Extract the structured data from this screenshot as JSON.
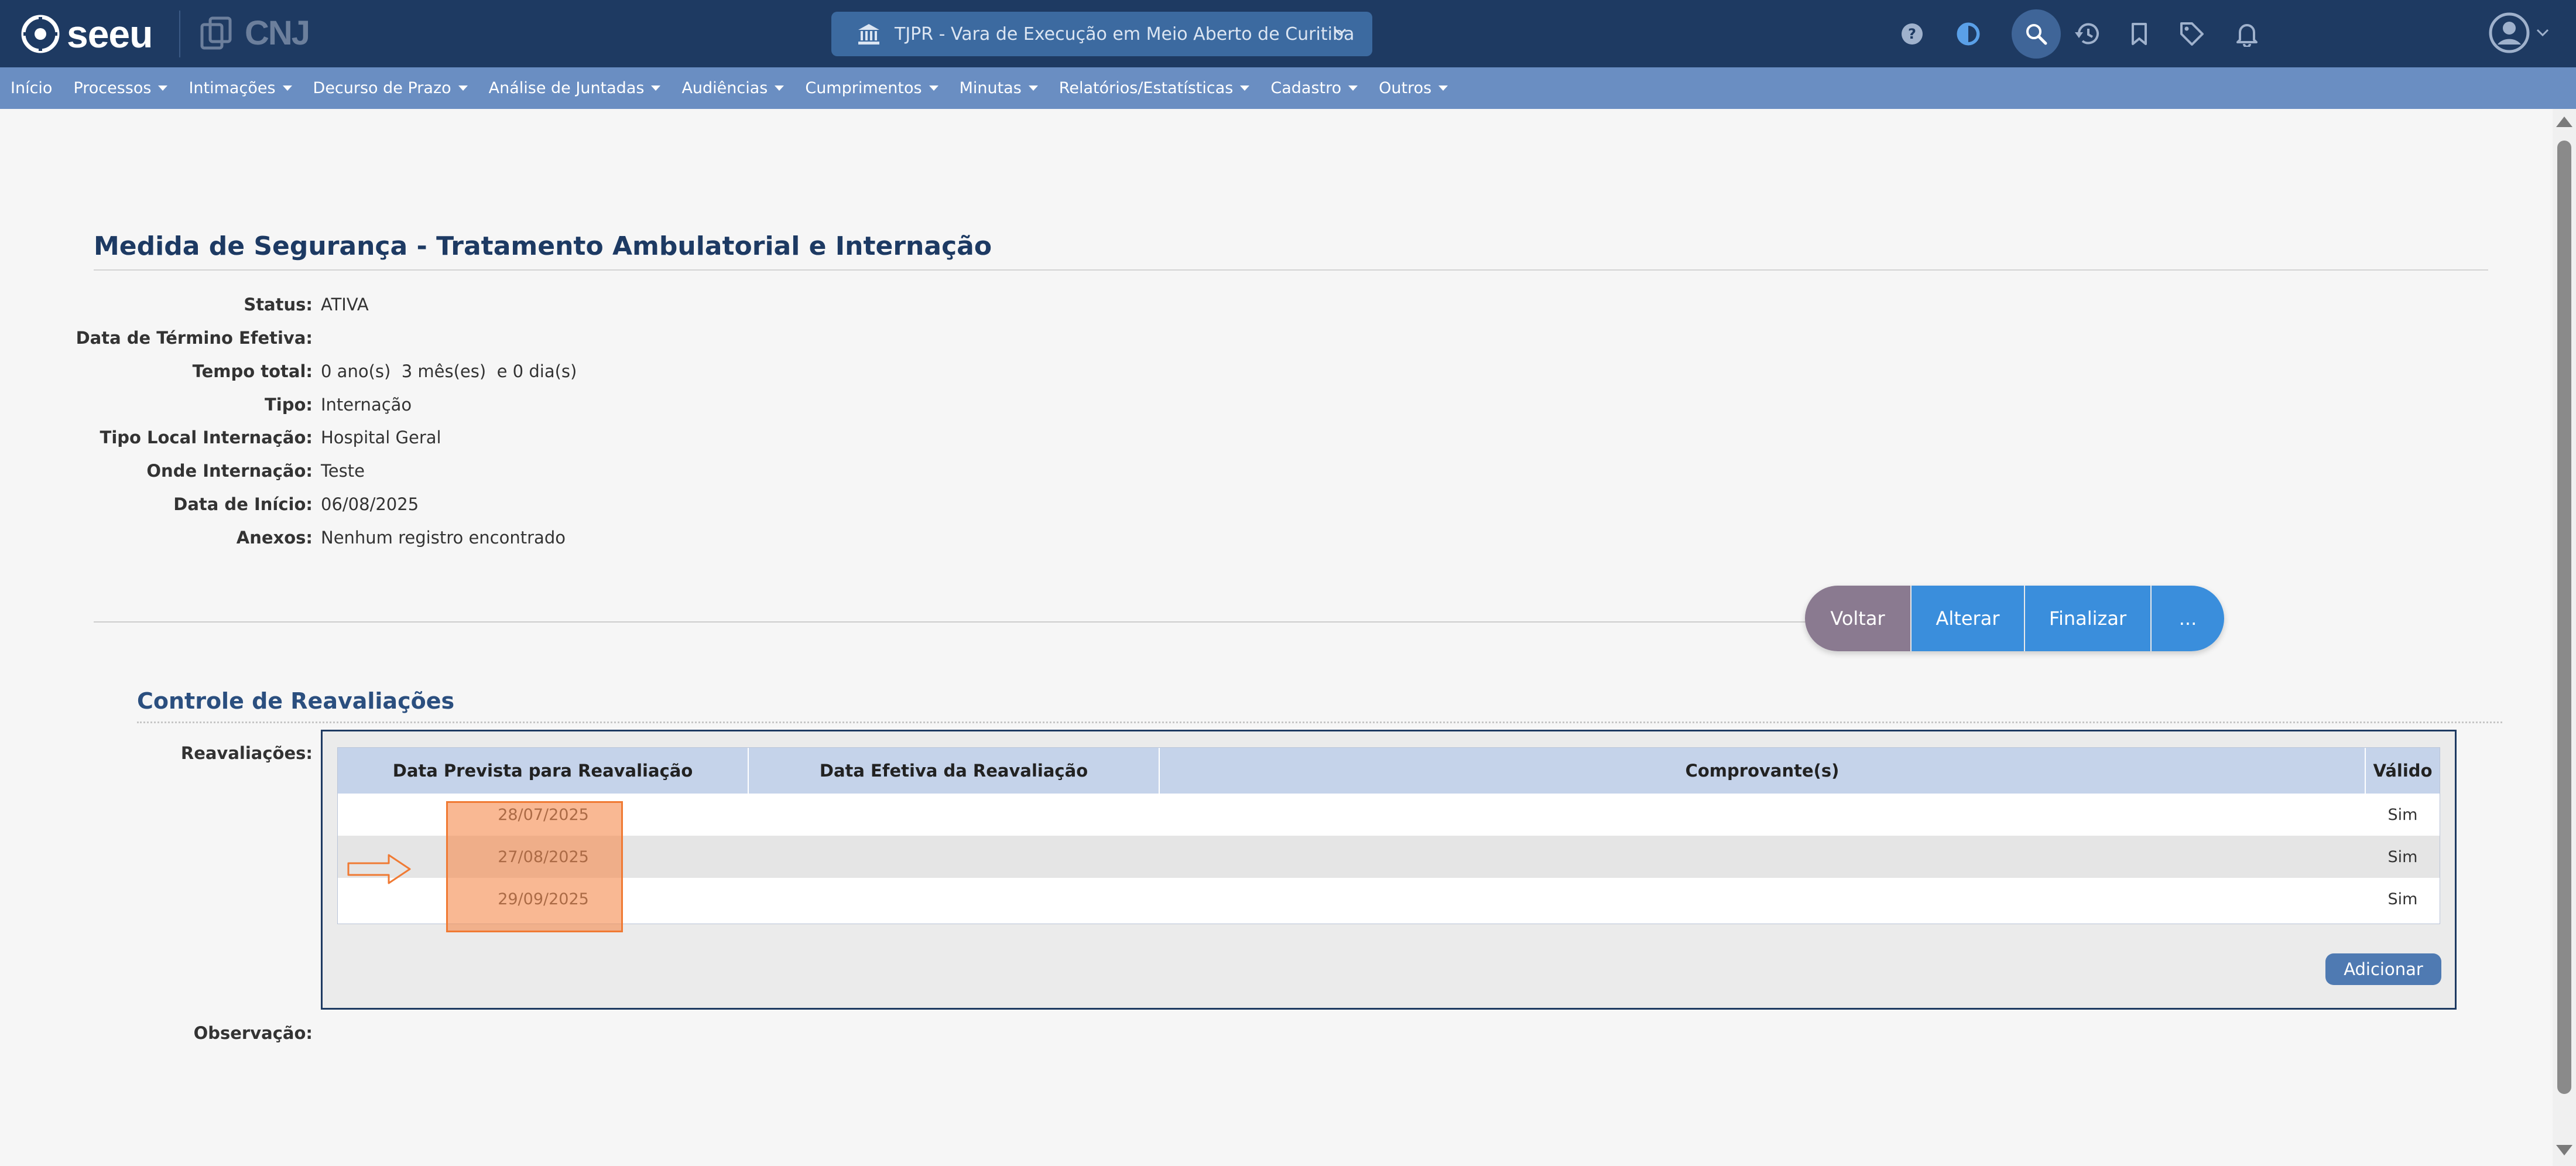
{
  "brand": {
    "name": "seeu",
    "partner": "CNJ",
    "icon": "seeu-logo-icon"
  },
  "court_selector": {
    "label": "TJPR - Vara de Execução em Meio Aberto de Curitiba",
    "icon": "court-building-icon"
  },
  "top_icons": [
    "help-icon",
    "theme-toggle-icon",
    "search-icon",
    "history-icon",
    "bookmark-icon",
    "tag-icon",
    "bell-icon",
    "user-avatar-icon"
  ],
  "menu": [
    {
      "label": "Início",
      "has_dropdown": false
    },
    {
      "label": "Processos",
      "has_dropdown": true
    },
    {
      "label": "Intimações",
      "has_dropdown": true
    },
    {
      "label": "Decurso de Prazo",
      "has_dropdown": true
    },
    {
      "label": "Análise de Juntadas",
      "has_dropdown": true
    },
    {
      "label": "Audiências",
      "has_dropdown": true
    },
    {
      "label": "Cumprimentos",
      "has_dropdown": true
    },
    {
      "label": "Minutas",
      "has_dropdown": true
    },
    {
      "label": "Relatórios/Estatísticas",
      "has_dropdown": true
    },
    {
      "label": "Cadastro",
      "has_dropdown": true
    },
    {
      "label": "Outros",
      "has_dropdown": true
    }
  ],
  "page": {
    "title": "Medida de Segurança - Tratamento Ambulatorial e Internação",
    "fields": [
      {
        "label": "Status:",
        "value": "ATIVA"
      },
      {
        "label": "Data de Término Efetiva:",
        "value": ""
      },
      {
        "label": "Tempo total:",
        "value": "0 ano(s)  3 mês(es)  e 0 dia(s)"
      },
      {
        "label": "Tipo:",
        "value": "Internação"
      },
      {
        "label": "Tipo Local Internação:",
        "value": "Hospital Geral"
      },
      {
        "label": "Onde Internação:",
        "value": "Teste"
      },
      {
        "label": "Data de Início:",
        "value": "06/08/2025"
      },
      {
        "label": "Anexos:",
        "value": "Nenhum registro encontrado"
      }
    ],
    "actions": {
      "voltar": "Voltar",
      "alterar": "Alterar",
      "finalizar": "Finalizar",
      "more": "..."
    }
  },
  "reavaliacoes": {
    "section_title": "Controle de Reavaliações",
    "field_label": "Reavaliações:",
    "observacao_label": "Observação:",
    "columns": [
      "Data Prevista para Reavaliação",
      "Data Efetiva da Reavaliação",
      "Comprovante(s)",
      "Válido"
    ],
    "rows": [
      {
        "prevista": "28/07/2025",
        "efetiva": "",
        "comprovante": "",
        "valido": "Sim"
      },
      {
        "prevista": "27/08/2025",
        "efetiva": "",
        "comprovante": "",
        "valido": "Sim"
      },
      {
        "prevista": "29/09/2025",
        "efetiva": "",
        "comprovante": "",
        "valido": "Sim"
      }
    ],
    "add_button": "Adicionar"
  },
  "colors": {
    "topbar": "#1e3a62",
    "menubar": "#6a8ec2",
    "primary": "#3a8edc",
    "highlight": "#f07a33"
  }
}
